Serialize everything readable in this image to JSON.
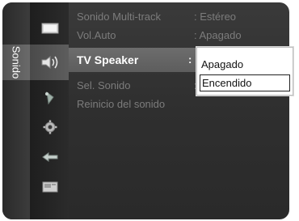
{
  "tab": {
    "label": "Sonido"
  },
  "menu": {
    "items": [
      {
        "label": "Sonido Multi-track",
        "value": ": Estéreo"
      },
      {
        "label": "Vol.Auto",
        "value": ": Apagado"
      },
      {
        "label": "TV Speaker",
        "value": ":"
      },
      {
        "label": "Sel. Sonido",
        "value": ":"
      },
      {
        "label": "Reinicio del sonido",
        "value": ""
      }
    ]
  },
  "dropdown": {
    "options": [
      "Apagado",
      "Encendido"
    ],
    "selected": "Encendido"
  },
  "icons": [
    "picture-icon",
    "sound-icon",
    "channel-icon",
    "setup-icon",
    "input-icon",
    "application-icon"
  ],
  "colors": {
    "highlight": "#5f5f5f",
    "dim_text": "#7c7c7c"
  }
}
